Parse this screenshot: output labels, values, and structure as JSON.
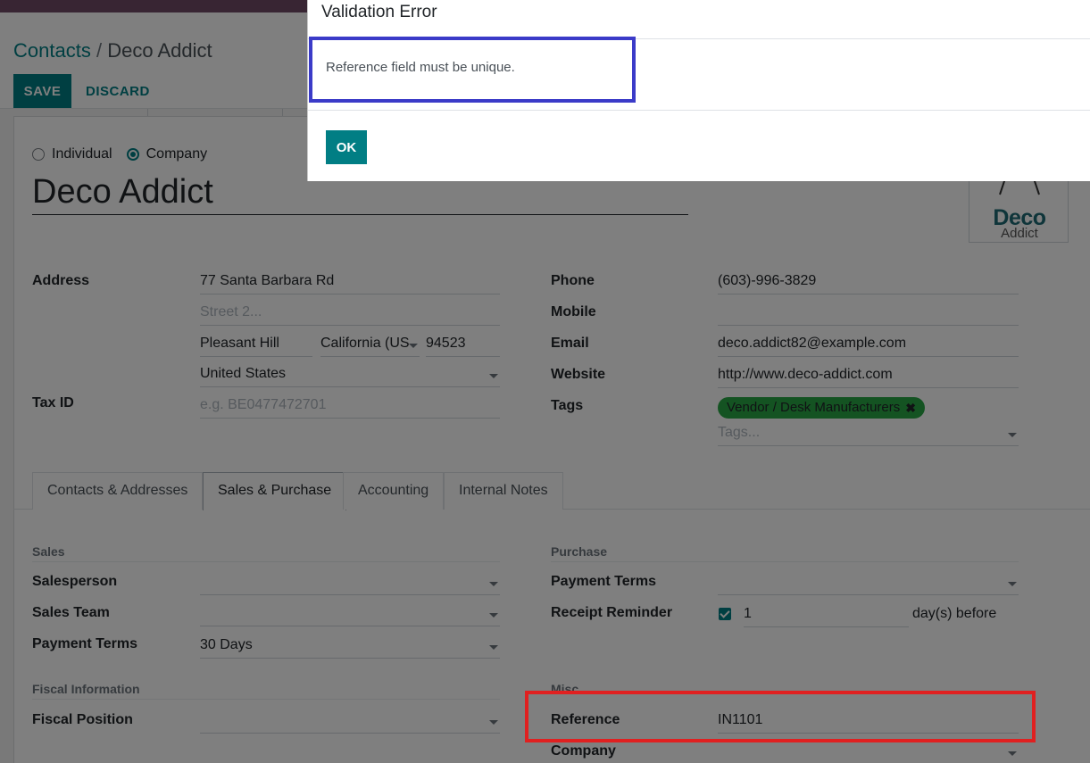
{
  "breadcrumb": {
    "parent": "Contacts",
    "separator": "/",
    "current": "Deco Addict"
  },
  "toolbar": {
    "save_label": "SAVE",
    "discard_label": "DISCARD"
  },
  "partner_type": {
    "individual": "Individual",
    "company": "Company",
    "selected": "company"
  },
  "name": "Deco Addict",
  "logo": {
    "main": "Deco",
    "sub": "Addict"
  },
  "address": {
    "label": "Address",
    "street": "77 Santa Barbara Rd",
    "street2_placeholder": "Street 2...",
    "city": "Pleasant Hill",
    "state": "California (US",
    "zip": "94523",
    "country": "United States"
  },
  "tax_id": {
    "label": "Tax ID",
    "placeholder": "e.g. BE0477472701"
  },
  "contact": {
    "phone_label": "Phone",
    "phone": "(603)-996-3829",
    "mobile_label": "Mobile",
    "mobile": "",
    "email_label": "Email",
    "email": "deco.addict82@example.com",
    "website_label": "Website",
    "website": "http://www.deco-addict.com",
    "tags_label": "Tags",
    "tag": "Vendor / Desk Manufacturers",
    "tags_placeholder": "Tags..."
  },
  "tabs": [
    {
      "label": "Contacts & Addresses"
    },
    {
      "label": "Sales & Purchase",
      "active": true
    },
    {
      "label": "Accounting"
    },
    {
      "label": "Internal Notes"
    }
  ],
  "sales": {
    "title": "Sales",
    "salesperson_label": "Salesperson",
    "sales_team_label": "Sales Team",
    "payment_terms_label": "Payment Terms",
    "payment_terms": "30 Days"
  },
  "purchase": {
    "title": "Purchase",
    "payment_terms_label": "Payment Terms",
    "receipt_reminder_label": "Receipt Reminder",
    "reminder_days": "1",
    "reminder_suffix": "day(s) before"
  },
  "fiscal": {
    "title": "Fiscal Information",
    "position_label": "Fiscal Position"
  },
  "misc": {
    "title": "Misc",
    "reference_label": "Reference",
    "reference": "IN1101",
    "company_label": "Company"
  },
  "dialog": {
    "title": "Validation Error",
    "message": "Reference field must be unique.",
    "ok_label": "OK"
  },
  "colors": {
    "brand": "#714B67",
    "primary": "#017e84",
    "highlight_blue": "#3b3bc8",
    "highlight_red": "#e02020"
  }
}
